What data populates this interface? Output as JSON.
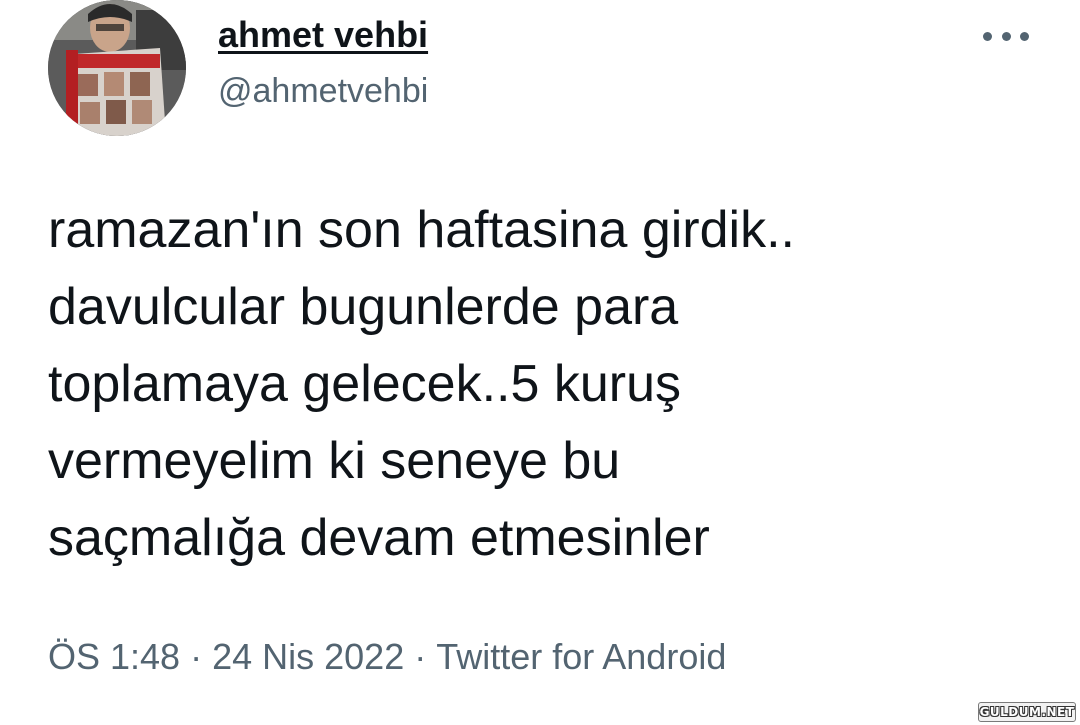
{
  "tweet": {
    "author": {
      "display_name": "ahmet vehbi",
      "handle": "@ahmetvehbi",
      "avatar_icon": "profile-photo"
    },
    "more_icon": "more-horizontal-icon",
    "text_lines": [
      "ramazan'ın son haftasina girdik..",
      "davulcular bugunlerde para",
      "toplamaya gelecek..5 kuruş",
      "vermeyelim ki seneye bu",
      "saçmalığa devam etmesinler"
    ],
    "meta": {
      "time": "ÖS 1:48",
      "date": "24 Nis 2022",
      "source": "Twitter for Android",
      "separator": "·"
    }
  },
  "watermark": "GULDUM.NET",
  "colors": {
    "text": "#0f1419",
    "secondary": "#536471",
    "background": "#ffffff"
  }
}
